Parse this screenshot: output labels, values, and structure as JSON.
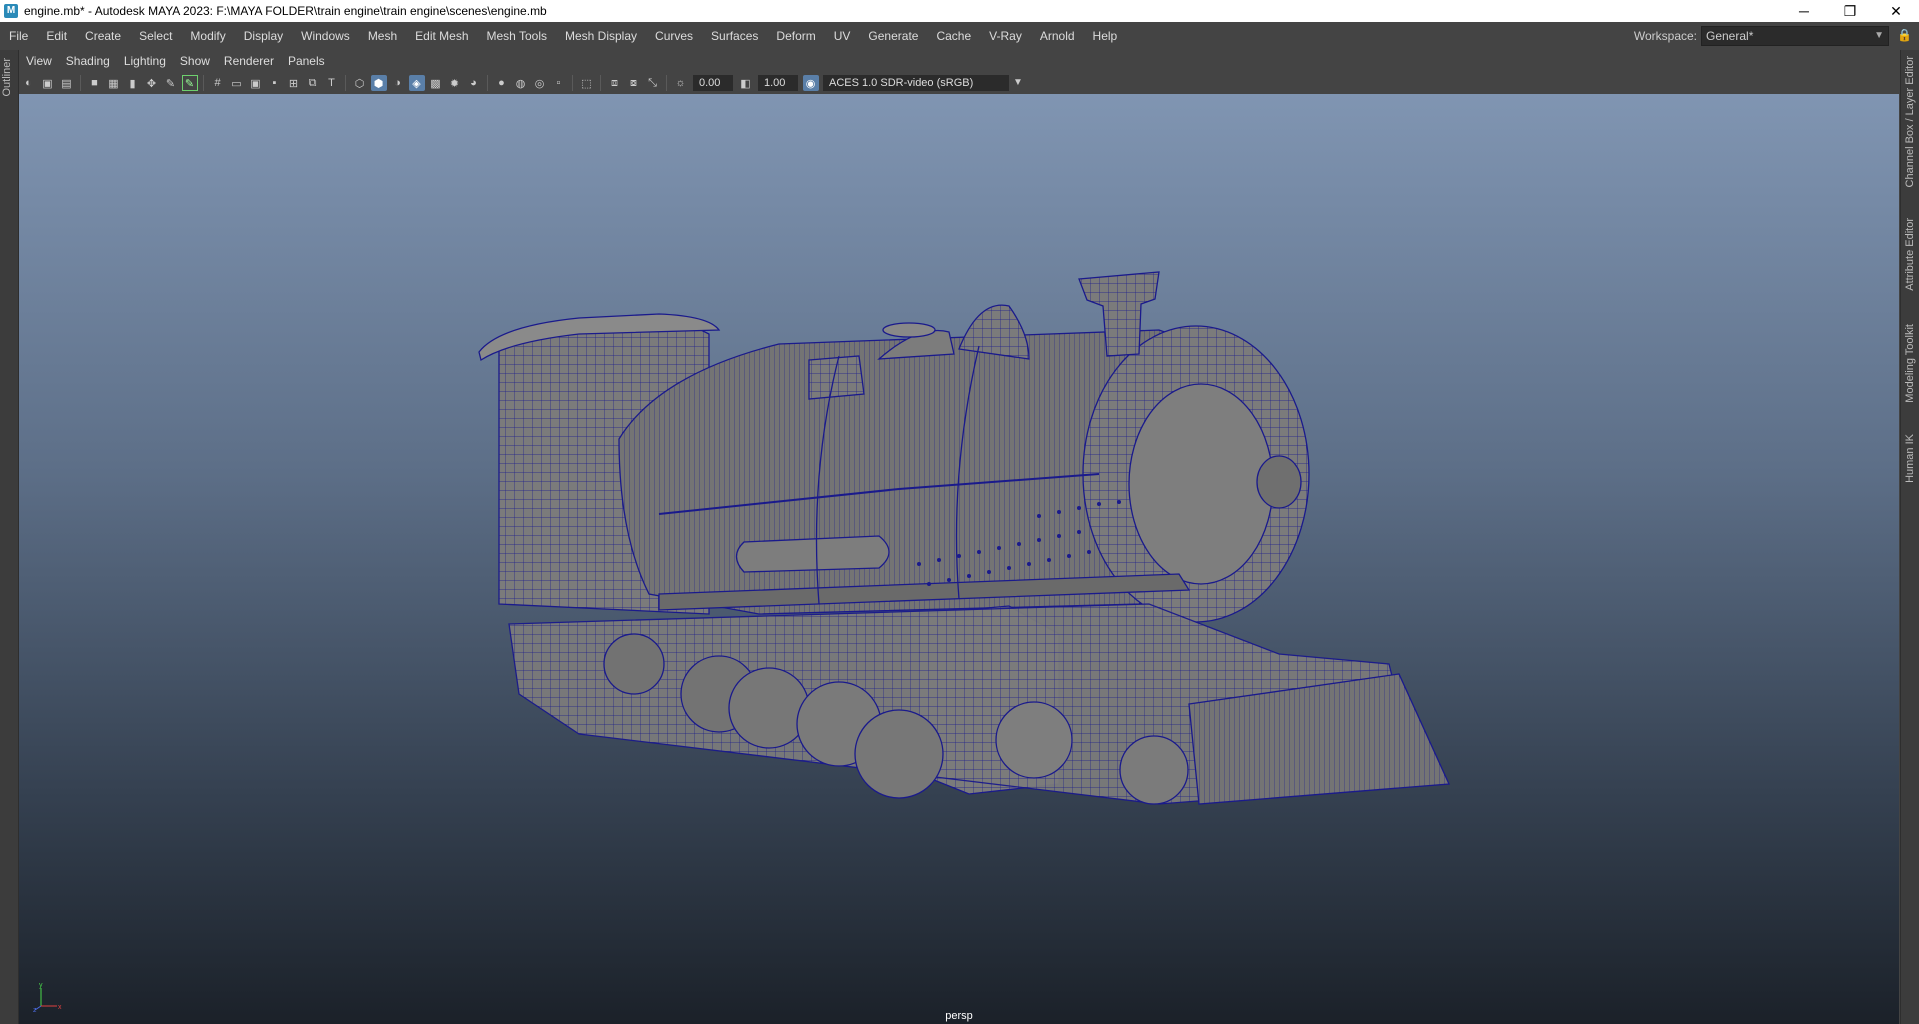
{
  "titlebar": {
    "title": "engine.mb* - Autodesk MAYA 2023: F:\\MAYA FOLDER\\train engine\\train engine\\scenes\\engine.mb",
    "icon": "maya-app-icon",
    "minimize": "─",
    "maximize": "❐",
    "close": "✕"
  },
  "menubar": {
    "items": [
      "File",
      "Edit",
      "Create",
      "Select",
      "Modify",
      "Display",
      "Windows",
      "Mesh",
      "Edit Mesh",
      "Mesh Tools",
      "Mesh Display",
      "Curves",
      "Surfaces",
      "Deform",
      "UV",
      "Generate",
      "Cache",
      "V-Ray",
      "Arnold",
      "Help"
    ]
  },
  "workspace": {
    "label": "Workspace:",
    "value": "General*"
  },
  "left_tabs": [
    "Outliner"
  ],
  "right_tabs": [
    "Channel Box / Layer Editor",
    "Attribute Editor",
    "Modeling Toolkit",
    "Human IK"
  ],
  "panel_menu": {
    "items": [
      "View",
      "Shading",
      "Lighting",
      "Show",
      "Renderer",
      "Panels"
    ]
  },
  "toolbar": {
    "exposure": "0.00",
    "gamma": "1.00",
    "color_management": "ACES 1.0 SDR-video (sRGB)"
  },
  "viewport": {
    "camera": "persp",
    "axis": {
      "y": "y",
      "z": "z",
      "x": "x"
    }
  },
  "colors": {
    "viewport_top": "#8095b2",
    "viewport_bottom": "#1b2129",
    "wireframe": "#1a1a8c",
    "model_shade": "#7a7a7a"
  }
}
